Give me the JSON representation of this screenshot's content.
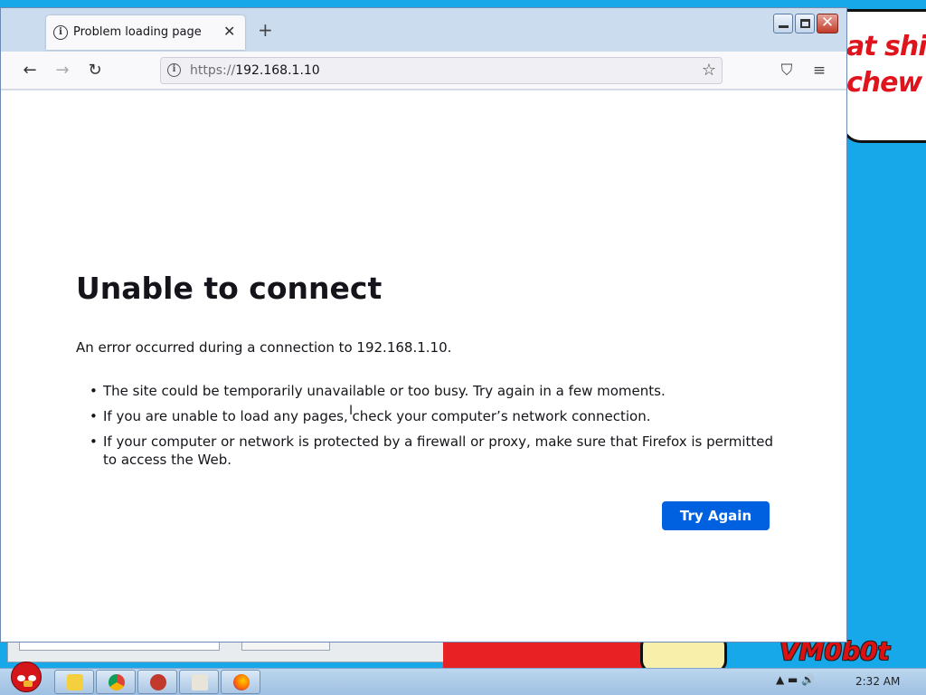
{
  "desktop": {
    "bubble_line1": "at shi",
    "bubble_line2": "chew",
    "watermark": "VM0b0t"
  },
  "browser": {
    "tab": {
      "title": "Problem loading page",
      "close_glyph": "✕"
    },
    "new_tab_glyph": "+",
    "window_buttons": {
      "close_glyph": "✕"
    },
    "nav": {
      "back_glyph": "←",
      "forward_glyph": "→",
      "reload_glyph": "↻"
    },
    "url": {
      "scheme": "https://",
      "host": "192.168.1.10"
    },
    "icons": {
      "info": "info-icon",
      "bookmark": "star-icon",
      "pocket": "pocket-icon",
      "menu": "hamburger-menu-icon"
    },
    "bookmark_glyph": "☆",
    "pocket_glyph": "⛉",
    "menu_glyph": "≡"
  },
  "error_page": {
    "title": "Unable to connect",
    "description": "An error occurred during a connection to 192.168.1.10.",
    "bullets": [
      "The site could be temporarily unavailable or too busy. Try again in a few moments.",
      "If you are unable to load any pages, check your computer’s network connection.",
      "If your computer or network is protected by a firewall or proxy, make sure that Firefox is permitted to access the Web."
    ],
    "try_again_label": "Try Again",
    "button_color": "#0061e0"
  },
  "taskbar": {
    "apps": [
      "explorer-icon",
      "chrome-icon",
      "dev-icon",
      "media-icon",
      "firefox-icon"
    ],
    "tray_glyphs": "▲  ▬  🔊",
    "clock": "2:32 AM"
  }
}
